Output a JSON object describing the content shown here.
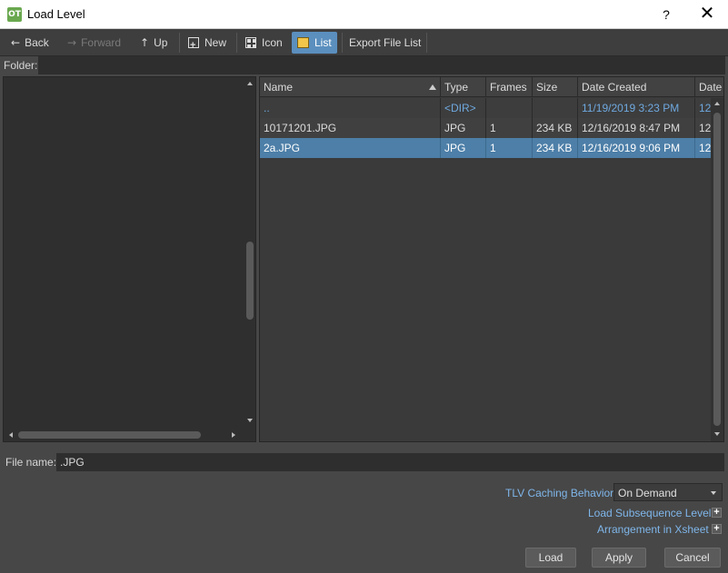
{
  "window": {
    "app_icon_text": "OT",
    "title": "Load Level",
    "help_label": "?",
    "close_label": "✕"
  },
  "toolbar": {
    "back": "Back",
    "forward": "Forward",
    "up": "Up",
    "new": "New",
    "icon": "Icon",
    "list": "List",
    "export": "Export File List"
  },
  "folder": {
    "label": "Folder:",
    "value": ""
  },
  "file_list": {
    "columns": [
      "Name",
      "Type",
      "Frames",
      "Size",
      "Date Created",
      "Date"
    ],
    "rows": [
      {
        "name": "..",
        "type": "<DIR>",
        "frames": "",
        "size": "",
        "date_created": "11/19/2019 3:23 PM",
        "date": "12"
      },
      {
        "name": "10171201.JPG",
        "type": "JPG",
        "frames": "1",
        "size": "234 KB",
        "date_created": "12/16/2019 8:47 PM",
        "date": "12"
      },
      {
        "name": "2a.JPG",
        "type": "JPG",
        "frames": "1",
        "size": "234 KB",
        "date_created": "12/16/2019 9:06 PM",
        "date": "12"
      }
    ]
  },
  "file_name": {
    "label": "File name:",
    "value": ".JPG"
  },
  "options": {
    "tlv_caching_label": "TLV Caching Behavior",
    "tlv_caching_value": "On Demand",
    "load_subsequence_label": "Load Subsequence Level",
    "arrangement_label": "Arrangement in Xsheet",
    "expand_symbol": "+"
  },
  "buttons": {
    "load": "Load",
    "apply": "Apply",
    "cancel": "Cancel"
  },
  "colors": {
    "selection": "#4d7fa8",
    "link_blue": "#7fb6ea",
    "active_tool": "#5b8fbe"
  }
}
